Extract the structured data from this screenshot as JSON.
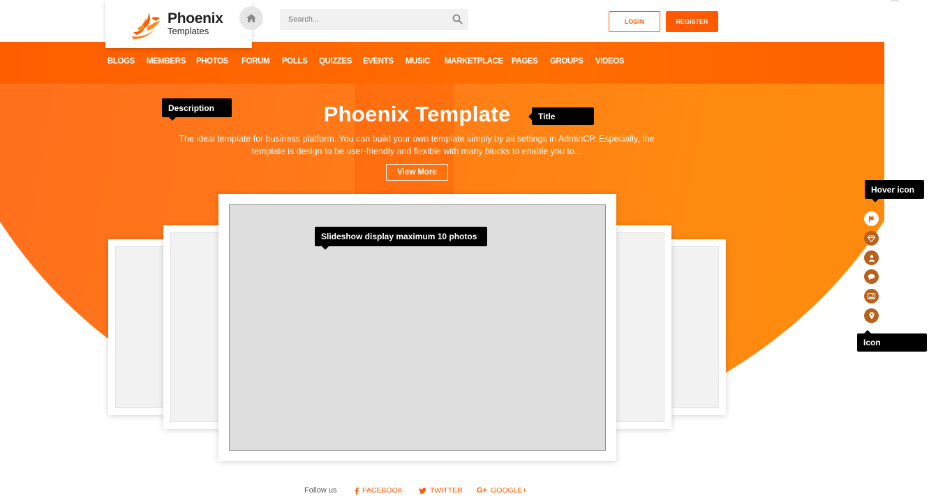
{
  "brand": {
    "name": "Phoenix",
    "tagline": "Templates"
  },
  "header": {
    "search_placeholder": "Search...",
    "login_label": "LOGIN",
    "register_label": "REGISTER"
  },
  "nav": [
    "BLOGS",
    "MEMBERS",
    "PHOTOS",
    "FORUM",
    "POLLS",
    "QUIZZES",
    "EVENTS",
    "MUSIC",
    "MARKETPLACE",
    "PAGES",
    "GROUPS",
    "VIDEOS"
  ],
  "hero": {
    "title": "Phoenix Template",
    "desc_line1": "The ideal template for business platform. You can build your own template simply by all settings in AdminCP. Especially, the",
    "desc_line2": "template is design to be user-friendly and flexible with many blocks to enable you to...",
    "cta": "View More"
  },
  "tooltips": {
    "description": "Description",
    "title": "Title",
    "slideshow": "Slideshow display maximum 10 photos",
    "hover_icon": "Hover icon",
    "icon": "Icon"
  },
  "side_icons": [
    "flag-icon",
    "diamond-icon",
    "user-icon",
    "comment-icon",
    "image-icon",
    "map-pin-icon"
  ],
  "footer": {
    "follow": "Follow us",
    "facebook": "FACEBOOK",
    "twitter": "TWITTER",
    "google": "GOOGLE+"
  },
  "colors": {
    "accent": "#ff5a00",
    "hero_orange": "#ff7a18",
    "side_icon": "#b8611c"
  }
}
